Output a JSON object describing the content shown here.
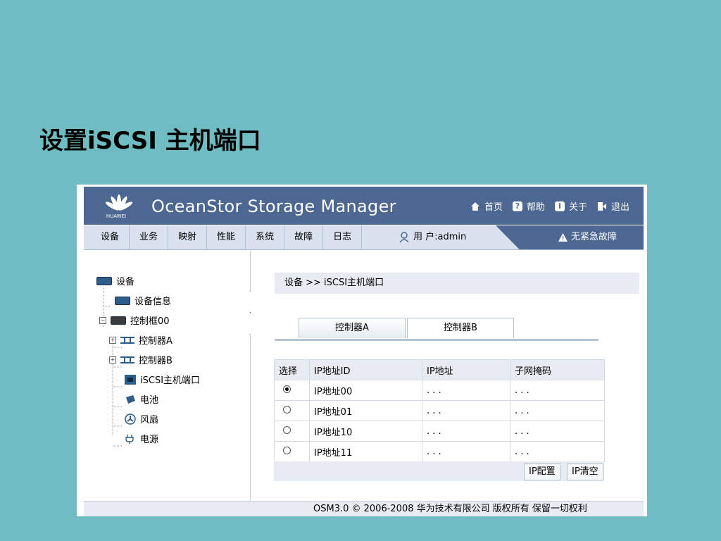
{
  "slide": {
    "title": "设置iSCSI 主机端口"
  },
  "header": {
    "logo_text": "HUAWEI",
    "app_title": "OceanStor Storage Manager",
    "links": [
      {
        "label": "首页",
        "icon": "home-icon"
      },
      {
        "label": "帮助",
        "icon": "help-icon"
      },
      {
        "label": "关于",
        "icon": "info-icon"
      },
      {
        "label": "退出",
        "icon": "exit-icon"
      }
    ]
  },
  "menubar": {
    "items": [
      "设备",
      "业务",
      "映射",
      "性能",
      "系统",
      "故障",
      "日志"
    ],
    "user": "用 户:admin",
    "alarm": "无紧急故障"
  },
  "tree": {
    "root": "设备",
    "device_info": "设备信息",
    "enclosure": "控制框00",
    "controller_a": "控制器A",
    "controller_b": "控制器B",
    "iscsi_port": "iSCSI主机端口",
    "battery": "电池",
    "fan": "风扇",
    "power": "电源"
  },
  "main": {
    "breadcrumb": "设备  >>  iSCSI主机端口",
    "tabs": [
      "控制器A",
      "控制器B"
    ],
    "table": {
      "headers": [
        "选择",
        "IP地址ID",
        "IP地址",
        "子网掩码"
      ],
      "rows": [
        {
          "selected": true,
          "id": "IP地址00",
          "ip": ". . .",
          "mask": ". . ."
        },
        {
          "selected": false,
          "id": "IP地址01",
          "ip": ". . .",
          "mask": ". . ."
        },
        {
          "selected": false,
          "id": "IP地址10",
          "ip": ". . .",
          "mask": ". . ."
        },
        {
          "selected": false,
          "id": "IP地址11",
          "ip": ". . .",
          "mask": ". . ."
        }
      ]
    },
    "buttons": {
      "config": "IP配置",
      "clear": "IP清空"
    }
  },
  "footer": {
    "text": "OSM3.0 © 2006-2008 华为技术有限公司 版权所有 保留一切权利"
  },
  "colors": {
    "background": "#6fbdc3",
    "header": "#4c6791",
    "menubar": "#d9e2ee"
  }
}
